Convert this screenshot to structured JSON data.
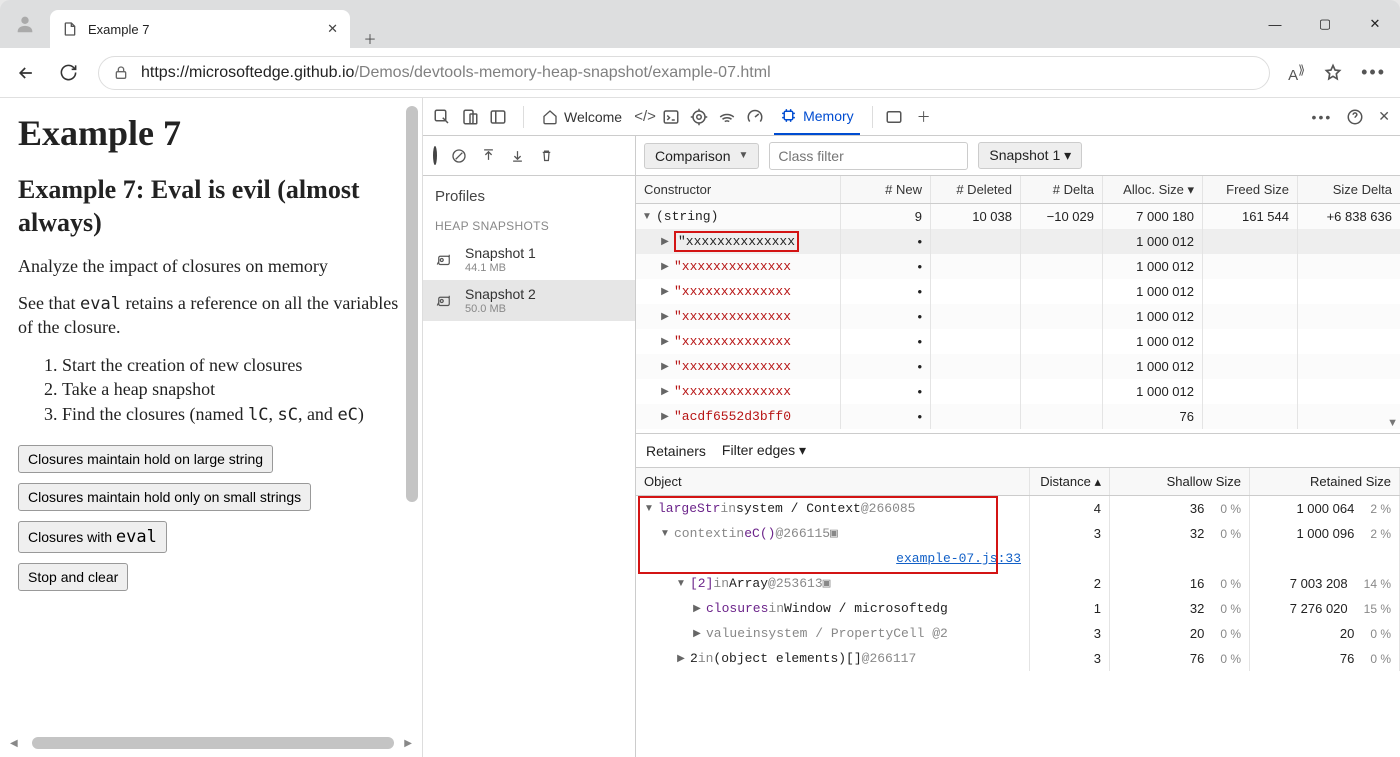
{
  "window": {
    "tab_title": "Example 7",
    "url_scheme_host": "https://microsoftedge.github.io",
    "url_path": "/Demos/devtools-memory-heap-snapshot/example-07.html"
  },
  "page": {
    "h1": "Example 7",
    "h2": "Example 7: Eval is evil (almost always)",
    "p1": "Analyze the impact of closures on memory",
    "p2_a": "See that ",
    "p2_code": "eval",
    "p2_b": " retains a reference on all the variables of the closure.",
    "li1": "Start the creation of new closures",
    "li2": "Take a heap snapshot",
    "li3_a": "Find the closures (named ",
    "li3_c1": "lC",
    "li3_mid1": ", ",
    "li3_c2": "sC",
    "li3_mid2": ", and ",
    "li3_c3": "eC",
    "li3_end": ")",
    "btn1": "Closures maintain hold on large string",
    "btn2": "Closures maintain hold only on small strings",
    "btn3_a": "Closures with ",
    "btn3_code": "eval",
    "btn4": "Stop and clear"
  },
  "devtools": {
    "welcome_label": "Welcome",
    "memory_label": "Memory",
    "profiles_title": "Profiles",
    "heap_section": "HEAP SNAPSHOTS",
    "snapshots": [
      {
        "name": "Snapshot 1",
        "size": "44.1 MB"
      },
      {
        "name": "Snapshot 2",
        "size": "50.0 MB"
      }
    ],
    "view_mode": "Comparison",
    "class_filter_placeholder": "Class filter",
    "baseline": "Snapshot 1 ▾",
    "columns": {
      "constructor": "Constructor",
      "new": "# New",
      "deleted": "# Deleted",
      "delta": "# Delta",
      "alloc": "Alloc. Size ▾",
      "freed": "Freed Size",
      "sized": "Size Delta"
    },
    "rows": [
      {
        "indent": 0,
        "tri": "▼",
        "label": "(string)",
        "red": false,
        "new": "9",
        "del": "10 038",
        "delta": "−10 029",
        "alloc": "7 000 180",
        "freed": "161 544",
        "sized": "+6 838 636",
        "highlight": false
      },
      {
        "indent": 1,
        "tri": "▶",
        "label": "\"xxxxxxxxxxxxxx",
        "red": false,
        "new": "•",
        "del": "",
        "delta": "",
        "alloc": "1 000 012",
        "freed": "",
        "sized": "",
        "highlight": true
      },
      {
        "indent": 1,
        "tri": "▶",
        "label": "\"xxxxxxxxxxxxxx",
        "red": true,
        "new": "•",
        "del": "",
        "delta": "",
        "alloc": "1 000 012",
        "freed": "",
        "sized": ""
      },
      {
        "indent": 1,
        "tri": "▶",
        "label": "\"xxxxxxxxxxxxxx",
        "red": true,
        "new": "•",
        "del": "",
        "delta": "",
        "alloc": "1 000 012",
        "freed": "",
        "sized": ""
      },
      {
        "indent": 1,
        "tri": "▶",
        "label": "\"xxxxxxxxxxxxxx",
        "red": true,
        "new": "•",
        "del": "",
        "delta": "",
        "alloc": "1 000 012",
        "freed": "",
        "sized": ""
      },
      {
        "indent": 1,
        "tri": "▶",
        "label": "\"xxxxxxxxxxxxxx",
        "red": true,
        "new": "•",
        "del": "",
        "delta": "",
        "alloc": "1 000 012",
        "freed": "",
        "sized": ""
      },
      {
        "indent": 1,
        "tri": "▶",
        "label": "\"xxxxxxxxxxxxxx",
        "red": true,
        "new": "•",
        "del": "",
        "delta": "",
        "alloc": "1 000 012",
        "freed": "",
        "sized": ""
      },
      {
        "indent": 1,
        "tri": "▶",
        "label": "\"xxxxxxxxxxxxxx",
        "red": true,
        "new": "•",
        "del": "",
        "delta": "",
        "alloc": "1 000 012",
        "freed": "",
        "sized": ""
      },
      {
        "indent": 1,
        "tri": "▶",
        "label": "\"acdf6552d3bff0",
        "red": true,
        "new": "•",
        "del": "",
        "delta": "",
        "alloc": "76",
        "freed": "",
        "sized": ""
      }
    ],
    "retainers_tab": "Retainers",
    "filter_edges": "Filter edges ▾",
    "ret_columns": {
      "obj": "Object",
      "dist": "Distance ▴",
      "shallow": "Shallow Size",
      "retained": "Retained Size"
    },
    "ret_rows": [
      {
        "indent": 0,
        "tri": "▼",
        "segments": [
          {
            "t": "largeStr",
            "c": "tok-prop"
          },
          {
            "t": " in ",
            "c": "tok-gray"
          },
          {
            "t": "system / Context ",
            "c": "tok-type"
          },
          {
            "t": "@266085",
            "c": "tok-id"
          }
        ],
        "dist": "4",
        "sh": "36",
        "shp": "0 %",
        "ret": "1 000 064",
        "retp": "2 %",
        "box": true
      },
      {
        "indent": 1,
        "tri": "▼",
        "segments": [
          {
            "t": "context",
            "c": "tok-gray"
          },
          {
            "t": " in ",
            "c": "tok-gray"
          },
          {
            "t": "eC()",
            "c": "tok-prop"
          },
          {
            "t": " @266115 ",
            "c": "tok-id"
          },
          {
            "t": "▣",
            "c": "tok-gray"
          }
        ],
        "dist": "3",
        "sh": "32",
        "shp": "0 %",
        "ret": "1 000 096",
        "retp": "2 %",
        "box": true
      },
      {
        "indent": 1,
        "tri": "",
        "segments": [
          {
            "t": "example-07.js:33",
            "c": "tok-link"
          }
        ],
        "right": true,
        "dist": "",
        "sh": "",
        "shp": "",
        "ret": "",
        "retp": "",
        "box": true
      },
      {
        "indent": 2,
        "tri": "▼",
        "segments": [
          {
            "t": "[2]",
            "c": "tok-prop"
          },
          {
            "t": " in ",
            "c": "tok-gray"
          },
          {
            "t": "Array ",
            "c": "tok-type"
          },
          {
            "t": "@253613 ",
            "c": "tok-id"
          },
          {
            "t": "▣",
            "c": "tok-gray"
          }
        ],
        "dist": "2",
        "sh": "16",
        "shp": "0 %",
        "ret": "7 003 208",
        "retp": "14 %"
      },
      {
        "indent": 3,
        "tri": "▶",
        "segments": [
          {
            "t": "closures",
            "c": "tok-prop"
          },
          {
            "t": " in ",
            "c": "tok-gray"
          },
          {
            "t": "Window / microsoftedg",
            "c": "tok-type"
          }
        ],
        "dist": "1",
        "sh": "32",
        "shp": "0 %",
        "ret": "7 276 020",
        "retp": "15 %"
      },
      {
        "indent": 3,
        "tri": "▶",
        "segments": [
          {
            "t": "value",
            "c": "tok-gray"
          },
          {
            "t": " in ",
            "c": "tok-gray"
          },
          {
            "t": "system / PropertyCell @2",
            "c": "tok-gray"
          }
        ],
        "dist": "3",
        "sh": "20",
        "shp": "0 %",
        "ret": "20",
        "retp": "0 %"
      },
      {
        "indent": 2,
        "tri": "▶",
        "segments": [
          {
            "t": "2",
            "c": "tok-type"
          },
          {
            "t": " in ",
            "c": "tok-gray"
          },
          {
            "t": "(object elements)[] ",
            "c": "tok-type"
          },
          {
            "t": "@266117",
            "c": "tok-id"
          }
        ],
        "dist": "3",
        "sh": "76",
        "shp": "0 %",
        "ret": "76",
        "retp": "0 %"
      }
    ]
  }
}
